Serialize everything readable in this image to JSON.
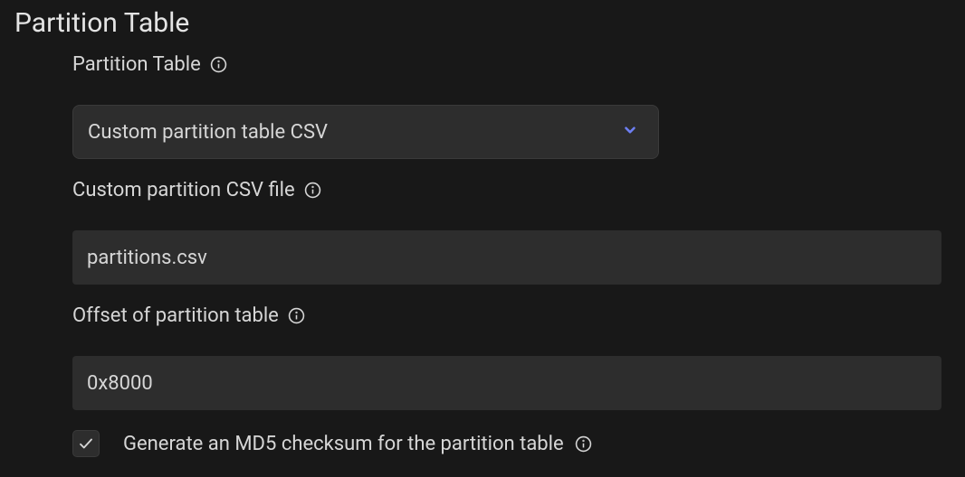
{
  "section": {
    "heading": "Partition Table"
  },
  "fields": {
    "partition_table": {
      "label": "Partition Table",
      "selected": "Custom partition table CSV"
    },
    "csv_file": {
      "label": "Custom partition CSV file",
      "value": "partitions.csv"
    },
    "offset": {
      "label": "Offset of partition table",
      "value": "0x8000"
    },
    "md5_checksum": {
      "label": "Generate an MD5 checksum for the partition table",
      "checked": true
    }
  },
  "colors": {
    "accent": "#6d7ff3"
  }
}
